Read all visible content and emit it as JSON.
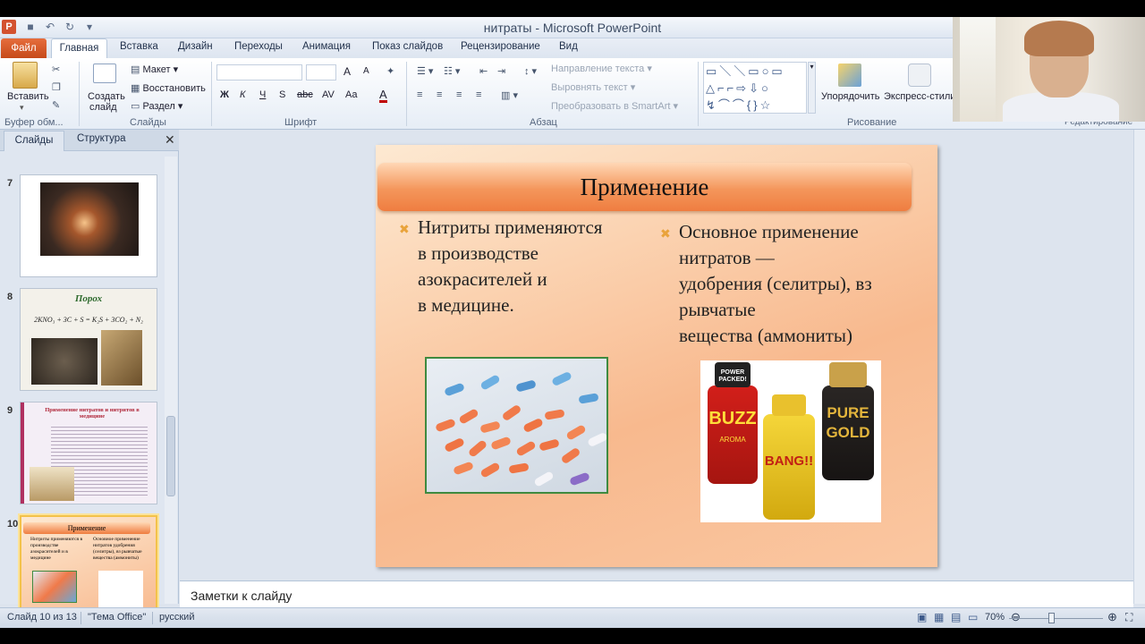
{
  "window": {
    "title": "нитраты - Microsoft PowerPoint",
    "app_icon": "P"
  },
  "ribbon_tabs": [
    "Файл",
    "Главная",
    "Вставка",
    "Дизайн",
    "Переходы",
    "Анимация",
    "Показ слайдов",
    "Рецензирование",
    "Вид"
  ],
  "ribbon": {
    "clipboard": {
      "paste": "Вставить",
      "group": "Буфер обм..."
    },
    "slides": {
      "create": "Создать",
      "create2": "слайд",
      "layout": "Макет",
      "reset": "Восстановить",
      "section": "Раздел",
      "group": "Слайды"
    },
    "font": {
      "group": "Шрифт",
      "bold": "Ж",
      "italic": "К",
      "underline": "Ч",
      "strike": "S",
      "abc": "abc",
      "spacing": "AV",
      "case": "Aa",
      "color": "A",
      "grow": "A",
      "shrink": "A"
    },
    "paragraph": {
      "group": "Абзац",
      "text_direction": "Направление текста",
      "align_text": "Выровнять текст",
      "smartart": "Преобразовать в SmartArt"
    },
    "drawing": {
      "arrange": "Упорядочить",
      "quick_styles": "Экспресс-стили",
      "group": "Рисование"
    },
    "editing": {
      "group": "Редактирование"
    }
  },
  "left_pane": {
    "tab_slides": "Слайды",
    "tab_outline": "Структура",
    "thumbs": [
      {
        "num": "7"
      },
      {
        "num": "8",
        "title": "Порох",
        "formula": "2KNO₃ + 3C + S = K₂S + 3CO₂ + N₂"
      },
      {
        "num": "9",
        "title": "Применение нитратов и нитритов в медицине"
      },
      {
        "num": "10",
        "title": "Применение",
        "left": "Нитриты применяются в производстве азокрасителей и в медицине",
        "right": "Основное применение нитратов удобрения (селитры), вз рывчатые вещества (аммониты)"
      }
    ]
  },
  "slide": {
    "title": "Применение",
    "left_bullet": "Нитриты применяются\nв производстве\nазокрасителей и\nв медицине.",
    "right_bullet": "Основное применение\nнитратов —\n удобрения (селитры), вз\nрывчатые\nвещества (аммониты)",
    "bottle_labels": [
      "POWER PACKED!",
      "BUZZ",
      "AROMA",
      "BANG!!",
      "PURE",
      "GOLD"
    ]
  },
  "notes": {
    "placeholder": "Заметки к слайду"
  },
  "status": {
    "slide_info": "Слайд 10 из 13",
    "theme": "\"Тема Office\"",
    "language": "русский",
    "zoom": "70%",
    "zoom_fraction": 0.45
  },
  "colors": {
    "accent_file_tab": "#d35230",
    "slide_title_bar": "#f4965b",
    "bullet_marker": "#e9a33b"
  }
}
